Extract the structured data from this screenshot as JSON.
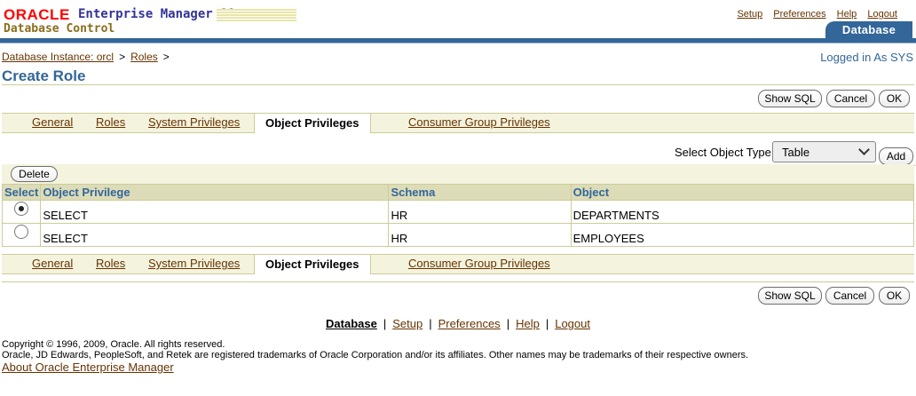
{
  "header": {
    "oracle": "ORACLE",
    "product": "Enterprise Manager 11",
    "product_g": "g",
    "subproduct": "Database Control",
    "global_links": [
      "Setup",
      "Preferences",
      "Help",
      "Logout"
    ],
    "database_tab": "Database"
  },
  "breadcrumb": {
    "items": [
      "Database Instance: orcl",
      "Roles"
    ],
    "separator": ">"
  },
  "logged_in": "Logged in As SYS",
  "page_title": "Create Role",
  "buttons": {
    "show_sql": "Show SQL",
    "cancel": "Cancel",
    "ok": "OK",
    "add": "Add",
    "delete": "Delete"
  },
  "tabs": [
    {
      "label": "General",
      "selected": false
    },
    {
      "label": "Roles",
      "selected": false
    },
    {
      "label": "System Privileges",
      "selected": false
    },
    {
      "label": "Object Privileges",
      "selected": true
    },
    {
      "label": "Consumer Group Privileges",
      "selected": false
    }
  ],
  "object_type": {
    "label": "Select Object Type",
    "selected": "Table"
  },
  "table": {
    "columns": [
      "Select",
      "Object Privilege",
      "Schema",
      "Object"
    ],
    "rows": [
      {
        "selected": true,
        "privilege": "SELECT",
        "schema": "HR",
        "object": "DEPARTMENTS"
      },
      {
        "selected": false,
        "privilege": "SELECT",
        "schema": "HR",
        "object": "EMPLOYEES"
      }
    ]
  },
  "footer": {
    "links": [
      "Database",
      "Setup",
      "Preferences",
      "Help",
      "Logout"
    ],
    "copyright_line1": "Copyright © 1996, 2009, Oracle. All rights reserved.",
    "copyright_line2": "Oracle, JD Edwards, PeopleSoft, and Retek are registered trademarks of Oracle Corporation and/or its affiliates. Other names may be trademarks of their respective owners.",
    "about": "About Oracle Enterprise Manager"
  },
  "colors": {
    "brand_blue": "#336699",
    "oracle_red": "#ff0000",
    "link_brown": "#663300",
    "tab_bar": "#f4f3de",
    "annotation_red": "#d01010"
  }
}
